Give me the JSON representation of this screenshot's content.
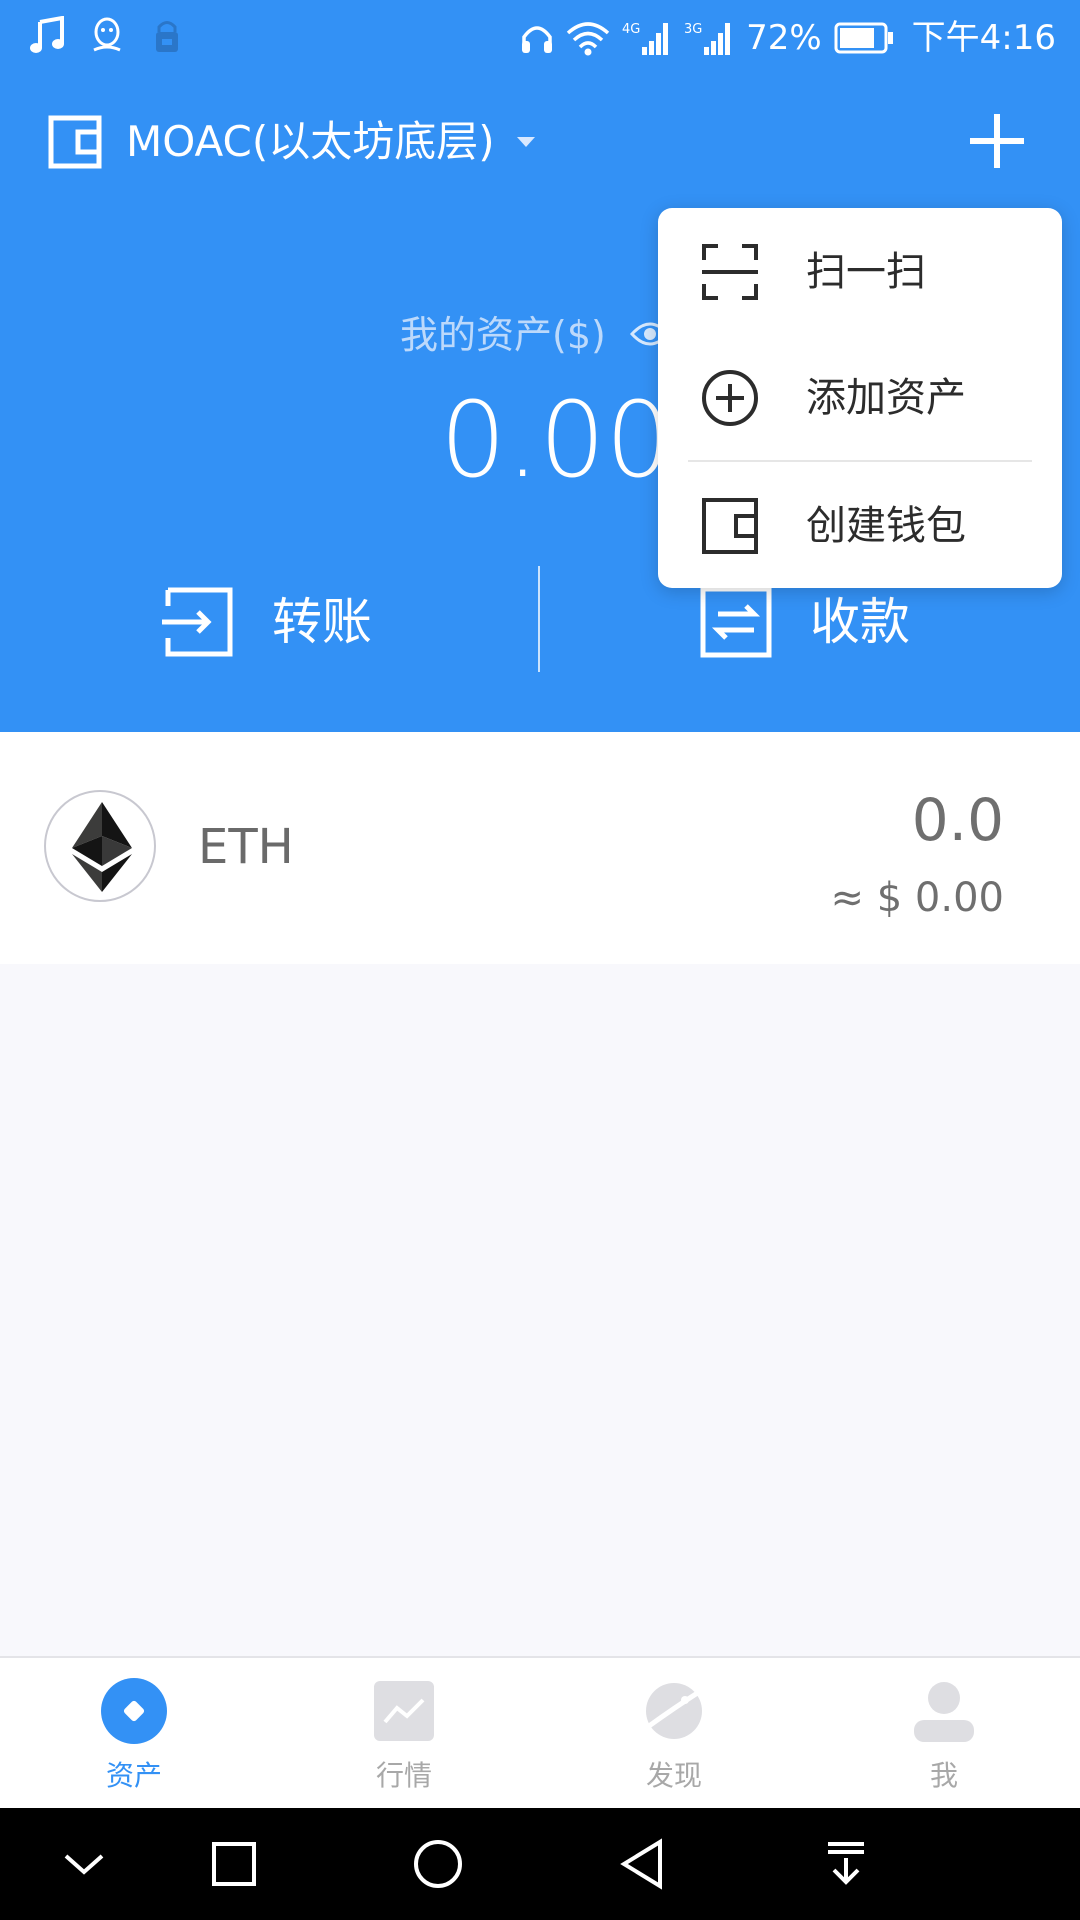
{
  "status_bar": {
    "battery_percent": "72%",
    "time": "下午4:16",
    "network_1": "4G",
    "network_2": "3G"
  },
  "header": {
    "wallet_name": "MOAC(以太坊底层)",
    "assets_label": "我的资产($)",
    "assets_value": "0.00",
    "transfer_label": "转账",
    "receive_label": "收款"
  },
  "menu": {
    "items": [
      {
        "label": "扫一扫",
        "icon": "scan-icon"
      },
      {
        "label": "添加资产",
        "icon": "add-circle-icon"
      },
      {
        "label": "创建钱包",
        "icon": "wallet-icon"
      }
    ]
  },
  "assets": [
    {
      "symbol": "ETH",
      "amount": "0.0",
      "fiat": "≈ $ 0.00",
      "icon": "ethereum-logo"
    }
  ],
  "tabs": [
    {
      "label": "资产",
      "icon": "assets-icon",
      "active": true
    },
    {
      "label": "行情",
      "icon": "market-chart-icon",
      "active": false
    },
    {
      "label": "发现",
      "icon": "planet-icon",
      "active": false
    },
    {
      "label": "我",
      "icon": "user-icon",
      "active": false
    }
  ],
  "colors": {
    "primary": "#3391f5",
    "background": "#f8f8fc",
    "inactive_tab": "#a8a8a8"
  }
}
